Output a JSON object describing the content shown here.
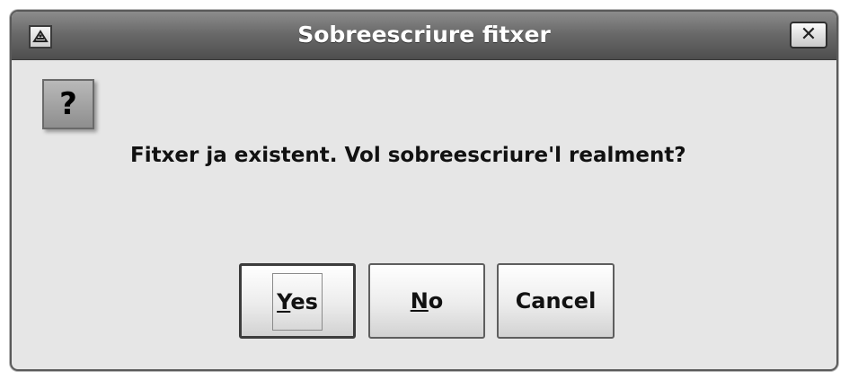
{
  "dialog": {
    "title": "Sobreescriure fitxer",
    "close_glyph": "✕",
    "app_icon": "java-app-icon",
    "message_icon": "question-icon",
    "message_icon_glyph": "?",
    "message": "Fitxer ja existent. Vol sobreescriure'l realment?"
  },
  "buttons": {
    "yes": {
      "mnemonic": "Y",
      "rest": "es",
      "focused": true
    },
    "no": {
      "mnemonic": "N",
      "rest": "o"
    },
    "cancel": {
      "label": "Cancel"
    }
  }
}
